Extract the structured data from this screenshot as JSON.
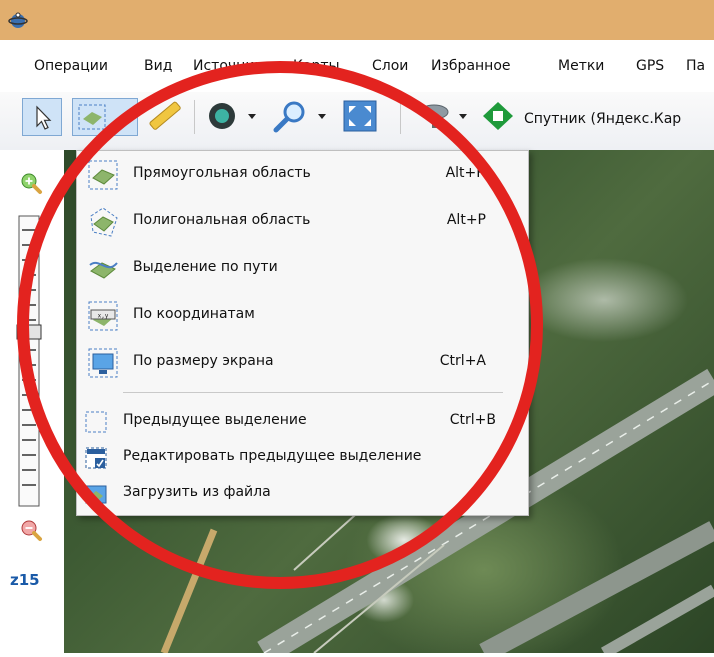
{
  "window": {
    "icon": "app-satellite-icon"
  },
  "menubar": {
    "items": [
      "Операции",
      "Вид",
      "Источник",
      "Карты",
      "Слои",
      "Избранное",
      "Метки",
      "GPS",
      "Па"
    ]
  },
  "toolbar": {
    "layer_label": "Спутник (Яндекс.Кар"
  },
  "left_panel": {
    "zoom_level": "z15"
  },
  "dropdown": {
    "items": [
      {
        "icon": "rect-selection-icon",
        "label": "Прямоугольная область",
        "shortcut": "Alt+R"
      },
      {
        "icon": "polygon-selection-icon",
        "label": "Полигональная область",
        "shortcut": "Alt+P"
      },
      {
        "icon": "path-selection-icon",
        "label": "Выделение по пути",
        "shortcut": ""
      },
      {
        "icon": "coordinates-selection-icon",
        "label": "По координатам",
        "shortcut": ""
      },
      {
        "icon": "screen-selection-icon",
        "label": "По размеру экрана",
        "shortcut": "Ctrl+A"
      }
    ],
    "secondary_items": [
      {
        "icon": "previous-selection-icon",
        "label": "Предыдущее выделение",
        "shortcut": "Ctrl+B"
      },
      {
        "icon": "edit-previous-selection-icon",
        "label": "Редактировать предыдущее выделение",
        "shortcut": ""
      },
      {
        "icon": "load-from-file-icon",
        "label": "Загрузить из файла",
        "shortcut": ""
      }
    ]
  },
  "colors": {
    "titlebar": "#e1ae6e",
    "highlight_ring": "#e3231f",
    "zoom_label": "#1a5aa8"
  }
}
